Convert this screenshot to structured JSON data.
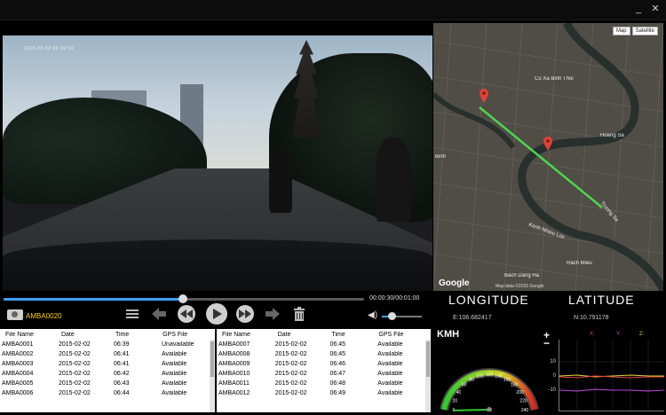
{
  "window": {
    "min_label": "_",
    "close_label": "✕"
  },
  "video": {
    "osd_text": "2015-02-02 06:39:59",
    "time_readout": "00:00:30/00:01:00",
    "progress_fraction": 0.5,
    "volume_fraction": 0.2,
    "current_file": "AMBA0020"
  },
  "map": {
    "type_map": "Map",
    "type_satellite": "Satellite",
    "labels": [
      "Hoang Sa",
      "Kenh Nhieu Loc",
      "Cu Xa Binh Thoi",
      "Rach Mieu",
      "Truong Sa",
      "Binh",
      "Bach Dang Ha"
    ],
    "google": "Google",
    "footer": "Map data ©2015 Google"
  },
  "gps": {
    "longitude_label": "LONGITUDE",
    "latitude_label": "LATITUDE",
    "longitude_value": "E:106.682417",
    "latitude_value": "N:10.791178"
  },
  "file_table": {
    "columns": [
      "File Name",
      "Date",
      "Time",
      "GPS File"
    ],
    "left_rows": [
      [
        "AMBA0001",
        "2015-02-02",
        "06:39",
        "Unavailable"
      ],
      [
        "AMBA0002",
        "2015-02-02",
        "06:41",
        "Available"
      ],
      [
        "AMBA0003",
        "2015-02-02",
        "06:41",
        "Available"
      ],
      [
        "AMBA0004",
        "2015-02-02",
        "06:42",
        "Available"
      ],
      [
        "AMBA0005",
        "2015-02-02",
        "06:43",
        "Available"
      ],
      [
        "AMBA0006",
        "2015-02-02",
        "06:44",
        "Available"
      ]
    ],
    "right_rows": [
      [
        "AMBA0007",
        "2015-02-02",
        "06:45",
        "Available"
      ],
      [
        "AMBA0008",
        "2015-02-02",
        "06:45",
        "Available"
      ],
      [
        "AMBA0009",
        "2015-02-02",
        "06:46",
        "Available"
      ],
      [
        "AMBA0010",
        "2015-02-02",
        "06:47",
        "Available"
      ],
      [
        "AMBA0011",
        "2015-02-02",
        "06:48",
        "Available"
      ],
      [
        "AMBA0012",
        "2015-02-02",
        "06:49",
        "Available"
      ]
    ]
  },
  "speed": {
    "unit_label": "KMH",
    "ticks": [
      "0",
      "20",
      "40",
      "60",
      "80",
      "100",
      "120",
      "140",
      "160",
      "180",
      "200",
      "220",
      "240"
    ],
    "value": 0
  },
  "gsensor": {
    "plus": "+",
    "minus": "−",
    "axis_ticks": [
      "10",
      "0",
      "-10"
    ],
    "legend": [
      {
        "label": "X:",
        "color": "#e23c3c"
      },
      {
        "label": "Y:",
        "color": "#c040e0"
      },
      {
        "label": "Z:",
        "color": "#e0d030"
      }
    ]
  },
  "colors": {
    "accent": "#3da0ff",
    "file_label": "#ffd000",
    "route": "#4cd64c",
    "pin": "#e2403a"
  }
}
